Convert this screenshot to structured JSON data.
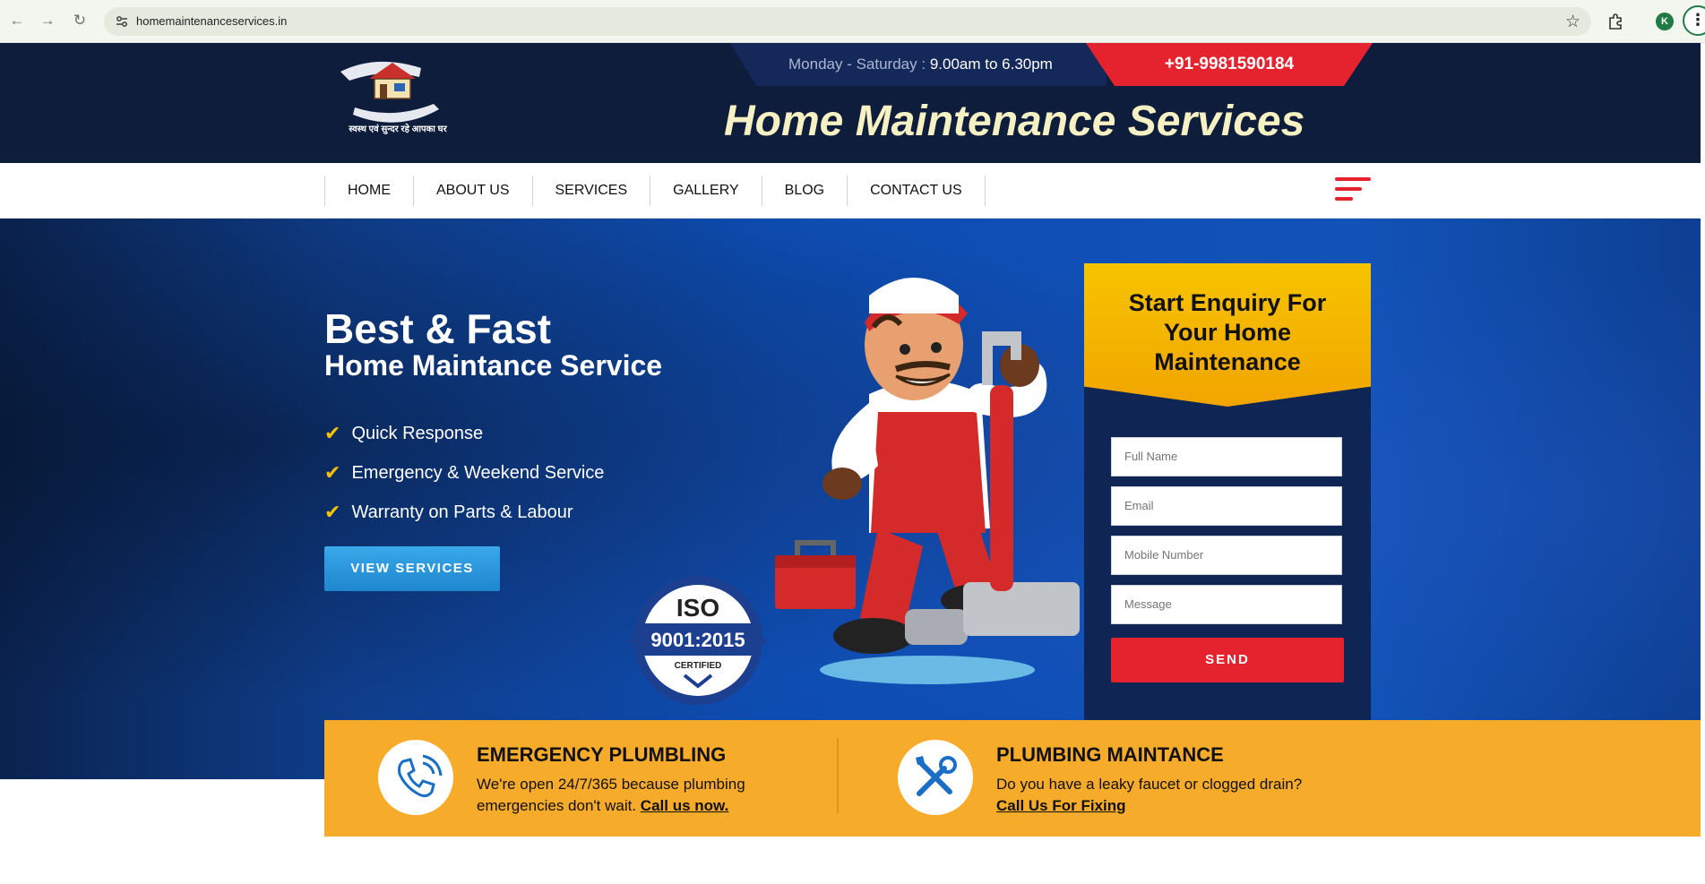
{
  "browser": {
    "url": "homemaintenanceservices.in",
    "avatar_letter": "K",
    "back_glyph": "←",
    "forward_glyph": "→",
    "reload_glyph": "↻",
    "star_glyph": "☆",
    "menu_glyph": "⋮"
  },
  "header": {
    "logo_tagline": "स्वस्थ एवं सुन्दर रहे आपका घर",
    "hours_label": "Monday - Saturday : ",
    "hours_time": "9.00am to 6.30pm",
    "phone": "+91-9981590184",
    "site_title": "Home Maintenance Services"
  },
  "nav": {
    "items": [
      {
        "label": "HOME"
      },
      {
        "label": "ABOUT US"
      },
      {
        "label": "SERVICES"
      },
      {
        "label": "GALLERY"
      },
      {
        "label": "BLOG"
      },
      {
        "label": "CONTACT US"
      }
    ]
  },
  "hero": {
    "title": "Best & Fast",
    "subtitle": "Home Maintance Service",
    "features": [
      {
        "text": "Quick Response"
      },
      {
        "text": "Emergency & Weekend Service"
      },
      {
        "text": "Warranty on Parts & Labour"
      }
    ],
    "check_glyph": "✔",
    "button_label": "VIEW SERVICES",
    "iso": {
      "top": "ISO",
      "number": "9001:2015",
      "bottom": "CERTIFIED"
    }
  },
  "enquiry": {
    "title": "Start Enquiry For Your Home Maintenance",
    "fields": {
      "full_name": "Full Name",
      "email": "Email",
      "mobile": "Mobile Number",
      "message": "Message"
    },
    "send_label": "SEND"
  },
  "services_band": {
    "emergency": {
      "title": "EMERGENCY PLUMBLING",
      "line1": "We're open 24/7/365 because plumbing",
      "line2": "emergencies don't wait. ",
      "link": "Call us now."
    },
    "maintenance": {
      "title": "PLUMBING MAINTANCE",
      "line1": "Do you have a leaky faucet or clogged drain?",
      "link": "Call Us For Fixing"
    }
  },
  "colors": {
    "navy": "#0f1d3c",
    "red": "#e5232e",
    "yellow": "#f7c400",
    "orange": "#f7ab2b",
    "blue_button": "#2b97dd"
  }
}
